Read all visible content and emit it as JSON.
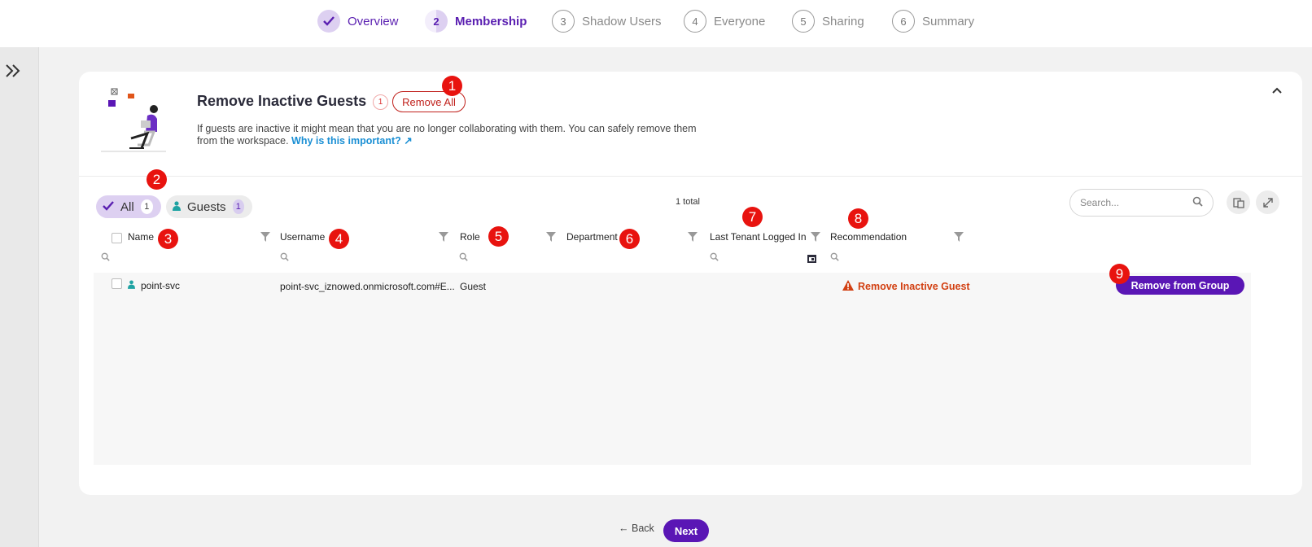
{
  "stepper": {
    "steps": [
      {
        "num": "",
        "label": "Overview"
      },
      {
        "num": "2",
        "label": "Membership"
      },
      {
        "num": "3",
        "label": "Shadow Users"
      },
      {
        "num": "4",
        "label": "Everyone"
      },
      {
        "num": "5",
        "label": "Sharing"
      },
      {
        "num": "6",
        "label": "Summary"
      }
    ]
  },
  "card": {
    "title": "Remove Inactive Guests",
    "count": "1",
    "remove_all_label": "Remove All",
    "description": "If guests are inactive it might mean that you are no longer collaborating with them. You can safely remove them from the workspace.",
    "link_text": "Why is this important?"
  },
  "filters": {
    "all_label": "All",
    "all_count": "1",
    "guests_label": "Guests",
    "guests_count": "1"
  },
  "total_text": "1 total",
  "search": {
    "placeholder": "Search..."
  },
  "table": {
    "columns": [
      "Name",
      "Username",
      "Role",
      "Department",
      "Last Tenant Logged In",
      "Recommendation"
    ],
    "rows": [
      {
        "name": "point-svc",
        "username": "point-svc_iznowed.onmicrosoft.com#E...",
        "role": "Guest",
        "department": "",
        "last_login": "",
        "recommendation": "Remove Inactive Guest",
        "action_label": "Remove from Group"
      }
    ]
  },
  "markers": [
    "1",
    "2",
    "3",
    "4",
    "5",
    "6",
    "7",
    "8",
    "9"
  ],
  "footer": {
    "back_label": "Back",
    "next_label": "Next"
  },
  "colors": {
    "accent": "#5a16b5",
    "danger": "#c0201b",
    "link": "#1a8fd4",
    "warning": "#d24012"
  }
}
